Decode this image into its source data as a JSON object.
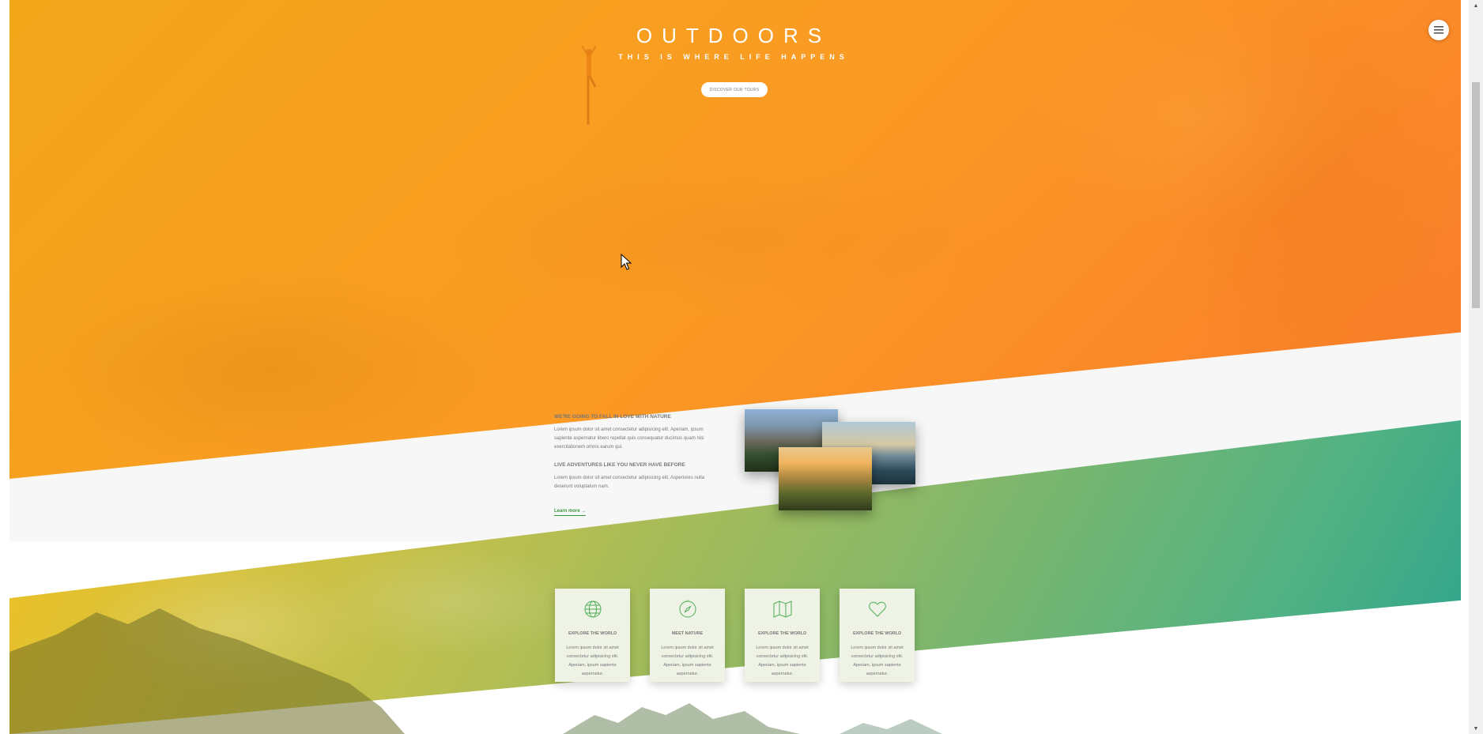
{
  "hero": {
    "title": "OUTDOORS",
    "subtitle": "THIS IS WHERE LIFE HAPPENS",
    "cta_label": "DISCOVER OUR TOURS",
    "gradient_colors": [
      "#f2a71a",
      "#fb9a24",
      "#f97a2c"
    ]
  },
  "nav": {
    "menu_icon": "hamburger-menu-icon"
  },
  "about": {
    "heading_1": "WE'RE GOING TO FALL IN LOVE WITH NATURE",
    "paragraph_1": "Lorem ipsum dolor sit amet consectetur adipisicing elit. Aperiam, ipsum sapiente aspernatur libero repellat quis consequatur ducimus quam nisi exercitationem omnis earum qui.",
    "heading_2": "LIVE ADVENTURES LIKE YOU NEVER HAVE BEFORE",
    "paragraph_2": "Lorem ipsum dolor sit amet consectetur adipisicing elit. Asperiores nulla deserunt voluptatum nam.",
    "learn_more": "Learn more →",
    "link_color": "#3a9a3a"
  },
  "features": [
    {
      "icon": "globe-icon",
      "title": "EXPLORE THE WORLD",
      "text": "Lorem ipsum dolor sit amet consectetur adipisicing elit. Aperiam, ipsum sapiente aspernatur."
    },
    {
      "icon": "compass-icon",
      "title": "MEET NATURE",
      "text": "Lorem ipsum dolor sit amet consectetur adipisicing elit. Aperiam, ipsum sapiente aspernatur."
    },
    {
      "icon": "map-icon",
      "title": "EXPLORE THE WORLD",
      "text": "Lorem ipsum dolor sit amet consectetur adipisicing elit. Aperiam, ipsum sapiente aspernatur."
    },
    {
      "icon": "heart-icon",
      "title": "EXPLORE THE WORLD",
      "text": "Lorem ipsum dolor sit amet consectetur adipisicing elit. Aperiam, ipsum sapiente aspernatur."
    }
  ],
  "theme": {
    "accent_green": "#3a9a3a",
    "band_gradient": [
      "#f1c122",
      "#8cb866",
      "#2aa28d"
    ]
  }
}
